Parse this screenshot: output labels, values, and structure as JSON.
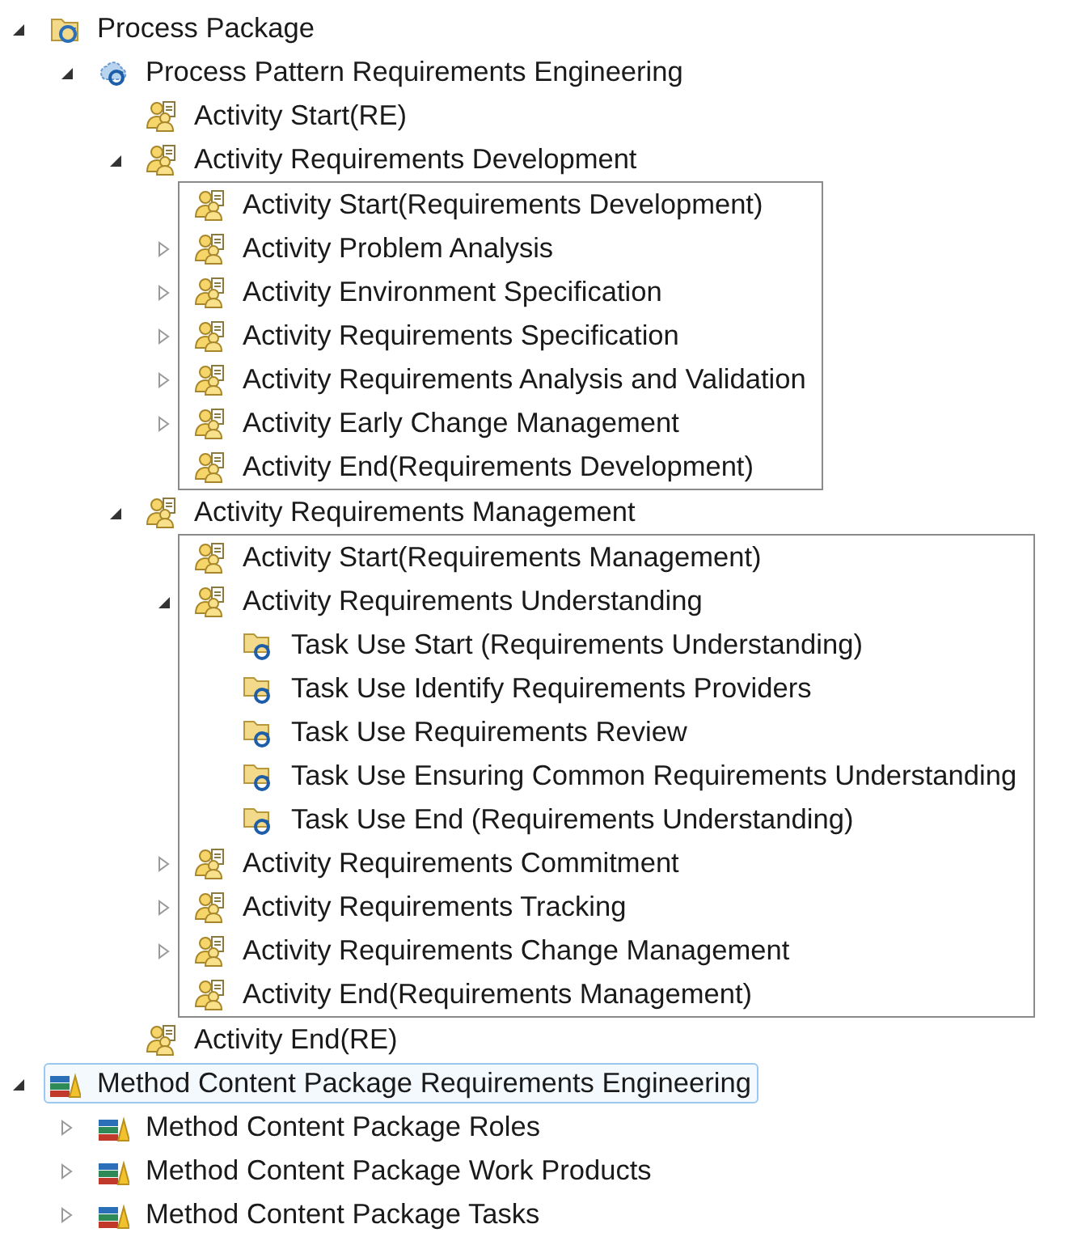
{
  "tree": [
    {
      "label": "Process Package",
      "kind": "package",
      "expanded": true,
      "focused": false,
      "children": [
        {
          "label": "Process Pattern Requirements Engineering",
          "kind": "process-pattern",
          "expanded": true,
          "children": [
            {
              "label": "Activity Start(RE)",
              "kind": "activity"
            },
            {
              "label": "Activity Requirements Development",
              "kind": "activity",
              "expanded": true,
              "framed": true,
              "children": [
                {
                  "label": "Activity Start(Requirements Development)",
                  "kind": "activity"
                },
                {
                  "label": "Activity Problem Analysis",
                  "kind": "activity",
                  "expanded": false
                },
                {
                  "label": "Activity Environment Specification",
                  "kind": "activity",
                  "expanded": false
                },
                {
                  "label": "Activity Requirements Specification",
                  "kind": "activity",
                  "expanded": false
                },
                {
                  "label": "Activity Requirements Analysis and Validation",
                  "kind": "activity",
                  "expanded": false
                },
                {
                  "label": "Activity Early Change Management",
                  "kind": "activity",
                  "expanded": false
                },
                {
                  "label": "Activity End(Requirements Development)",
                  "kind": "activity"
                }
              ]
            },
            {
              "label": "Activity Requirements Management",
              "kind": "activity",
              "expanded": true,
              "framed": true,
              "children": [
                {
                  "label": "Activity Start(Requirements Management)",
                  "kind": "activity"
                },
                {
                  "label": "Activity Requirements Understanding",
                  "kind": "activity",
                  "expanded": true,
                  "children": [
                    {
                      "label": "Task Use Start (Requirements Understanding)",
                      "kind": "task-use"
                    },
                    {
                      "label": "Task Use Identify Requirements Providers",
                      "kind": "task-use"
                    },
                    {
                      "label": "Task Use Requirements Review",
                      "kind": "task-use"
                    },
                    {
                      "label": "Task Use Ensuring Common Requirements Understanding",
                      "kind": "task-use"
                    },
                    {
                      "label": "Task Use End (Requirements Understanding)",
                      "kind": "task-use"
                    }
                  ]
                },
                {
                  "label": "Activity Requirements Commitment",
                  "kind": "activity",
                  "expanded": false
                },
                {
                  "label": "Activity Requirements Tracking",
                  "kind": "activity",
                  "expanded": false
                },
                {
                  "label": "Activity Requirements Change Management",
                  "kind": "activity",
                  "expanded": false
                },
                {
                  "label": "Activity End(Requirements Management)",
                  "kind": "activity"
                }
              ]
            },
            {
              "label": "Activity End(RE)",
              "kind": "activity"
            }
          ]
        }
      ]
    },
    {
      "label": "Method Content Package Requirements Engineering",
      "kind": "method-package",
      "expanded": true,
      "focused": true,
      "children": [
        {
          "label": "Method Content Package Roles",
          "kind": "method-package",
          "expanded": false
        },
        {
          "label": "Method Content Package Work Products",
          "kind": "method-package",
          "expanded": false
        },
        {
          "label": "Method Content Package Tasks",
          "kind": "method-package",
          "expanded": false
        }
      ]
    }
  ]
}
